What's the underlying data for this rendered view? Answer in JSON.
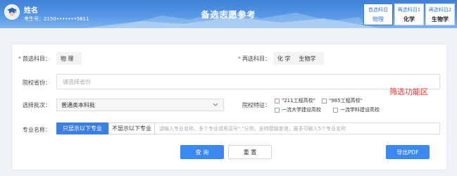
{
  "header": {
    "user_name": "姓名",
    "user_id": "考生号：2150•••••••5611",
    "title": "备选志愿参考",
    "tabs": [
      {
        "head": "首选科目",
        "value": "物理",
        "active": true
      },
      {
        "head": "再选科目1",
        "value": "化学",
        "active": false
      },
      {
        "head": "再选科目2",
        "value": "生物学",
        "active": false
      }
    ]
  },
  "form": {
    "first_subject": {
      "label": "首选科目：",
      "values": [
        "物 理"
      ]
    },
    "second_subject": {
      "label": "再选科目：",
      "values": [
        "化 学",
        "生物学"
      ]
    },
    "province": {
      "label": "院校省份：",
      "placeholder": "请选择省份"
    },
    "batch": {
      "label": "选择批次：",
      "value": "普通类本科批"
    },
    "features": {
      "label": "院校特征：",
      "options": [
        "\"211工程高校\"",
        "\"985工程高校\"",
        "一流大学建设高校",
        "一流学科建设高校"
      ]
    },
    "annotation": "筛选功能区",
    "major": {
      "label": "专业名称：",
      "toggle_on": "只显示以下专业",
      "toggle_off": "不显示以下专业",
      "placeholder": "请输入专业名称、多个专业请用逗号\",\"分割，支持模糊查询，最多可输入5个专业名称"
    },
    "buttons": {
      "query": "查 询",
      "reset": "重 置",
      "export": "导出PDF"
    }
  },
  "colors": {
    "accent": "#3b7fe0",
    "header": "#4d8ee0",
    "annotation": "#e53935"
  }
}
